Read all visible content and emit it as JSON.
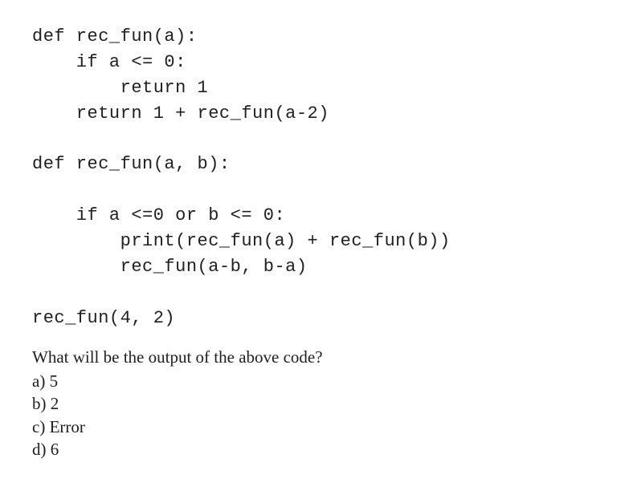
{
  "code": {
    "line1": "def rec_fun(a):",
    "line2": "    if a <= 0:",
    "line3": "        return 1",
    "line4": "    return 1 + rec_fun(a-2)",
    "line5": "",
    "line6": "def rec_fun(a, b):",
    "line7": "",
    "line8": "    if a <=0 or b <= 0:",
    "line9": "        print(rec_fun(a) + rec_fun(b))",
    "line10": "        rec_fun(a-b, b-a)",
    "line11": "",
    "line12": "rec_fun(4, 2)"
  },
  "question": "What will be the output of the above code?",
  "options": {
    "a": "a) 5",
    "b": "b) 2",
    "c": "c) Error",
    "d": "d) 6"
  }
}
